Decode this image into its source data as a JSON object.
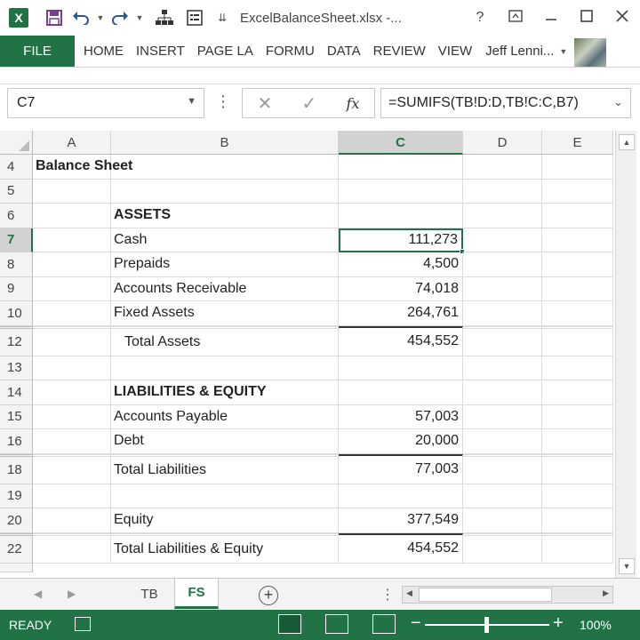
{
  "titlebar": {
    "app_icon": "X",
    "title": "ExcelBalanceSheet.xlsx -...",
    "help": "?",
    "icons": [
      "save-icon",
      "undo-icon",
      "redo-icon",
      "org-chart-icon",
      "form-icon"
    ]
  },
  "ribbon": {
    "tabs": [
      "FILE",
      "HOME",
      "INSERT",
      "PAGE LA",
      "FORMU",
      "DATA",
      "REVIEW",
      "VIEW"
    ],
    "user": "Jeff Lenni..."
  },
  "formula_bar": {
    "name_box": "C7",
    "cancel": "✕",
    "enter": "✓",
    "fx": "fx",
    "formula": "=SUMIFS(TB!D:D,TB!C:C,B7)"
  },
  "grid": {
    "columns": [
      "A",
      "B",
      "C",
      "D",
      "E"
    ],
    "rows": [
      {
        "num": "4",
        "a": "Balance Sheet",
        "b": "",
        "c": ""
      },
      {
        "num": "5",
        "a": "",
        "b": "",
        "c": ""
      },
      {
        "num": "6",
        "a": "",
        "b": "ASSETS",
        "c": ""
      },
      {
        "num": "7",
        "a": "",
        "b": "Cash",
        "c": "111,273"
      },
      {
        "num": "8",
        "a": "",
        "b": "Prepaids",
        "c": "4,500"
      },
      {
        "num": "9",
        "a": "",
        "b": "Accounts Receivable",
        "c": "74,018"
      },
      {
        "num": "10",
        "a": "",
        "b": "Fixed Assets",
        "c": "264,761"
      },
      {
        "num": "12",
        "a": "",
        "b": "Total Assets",
        "c": "454,552"
      },
      {
        "num": "13",
        "a": "",
        "b": "",
        "c": ""
      },
      {
        "num": "14",
        "a": "",
        "b": "LIABILITIES & EQUITY",
        "c": ""
      },
      {
        "num": "15",
        "a": "",
        "b": "Accounts Payable",
        "c": "57,003"
      },
      {
        "num": "16",
        "a": "",
        "b": "Debt",
        "c": "20,000"
      },
      {
        "num": "18",
        "a": "",
        "b": "Total Liabilities",
        "c": "77,003"
      },
      {
        "num": "19",
        "a": "",
        "b": "",
        "c": ""
      },
      {
        "num": "20",
        "a": "",
        "b": "Equity",
        "c": "377,549"
      },
      {
        "num": "22",
        "a": "",
        "b": "Total Liabilities & Equity",
        "c": "454,552"
      }
    ],
    "active_cell": "C7"
  },
  "sheets": {
    "tabs": [
      "TB",
      "FS"
    ],
    "active": "FS"
  },
  "status": {
    "mode": "READY",
    "zoom": "100%",
    "zoom_level_fraction": 0.5
  },
  "colors": {
    "accent": "#217346"
  }
}
